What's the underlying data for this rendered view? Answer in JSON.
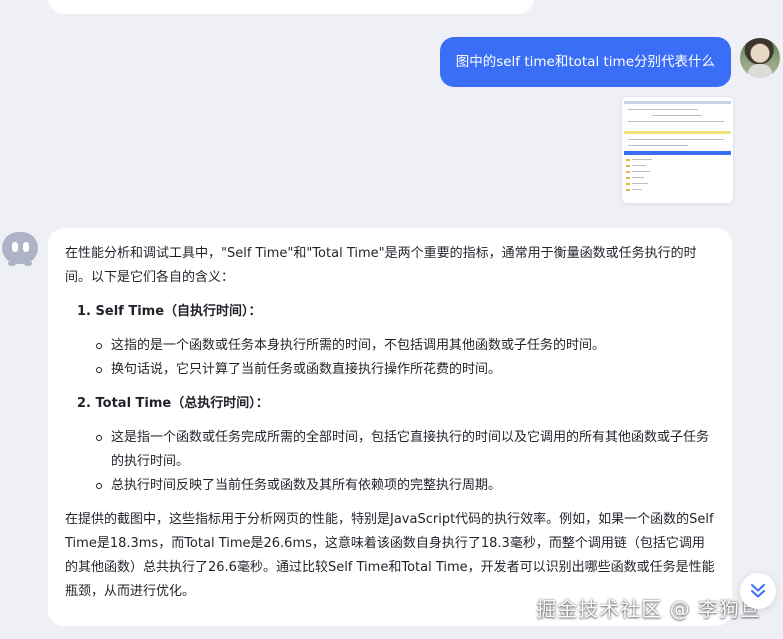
{
  "conversation": {
    "user_message": "图中的self time和total time分别代表什么",
    "answer": {
      "intro": "在性能分析和调试工具中，\"Self Time\"和\"Total Time\"是两个重要的指标，通常用于衡量函数或任务执行的时间。以下是它们各自的含义：",
      "sections": [
        {
          "heading": "1. Self Time（自执行时间）：",
          "bullets": [
            "这指的是一个函数或任务本身执行所需的时间，不包括调用其他函数或子任务的时间。",
            "换句话说，它只计算了当前任务或函数直接执行操作所花费的时间。"
          ]
        },
        {
          "heading": "2. Total Time（总执行时间）：",
          "bullets": [
            "这是指一个函数或任务完成所需的全部时间，包括它直接执行的时间以及它调用的所有其他函数或子任务的执行时间。",
            "总执行时间反映了当前任务或函数及其所有依赖项的完整执行周期。"
          ]
        }
      ],
      "closing": "在提供的截图中，这些指标用于分析网页的性能，特别是JavaScript代码的执行效率。例如，如果一个函数的Self Time是18.3ms，而Total Time是26.6ms，这意味着该函数自身执行了18.3毫秒，而整个调用链（包括它调用的其他函数）总共执行了26.6毫秒。通过比较Self Time和Total Time，开发者可以识别出哪些函数或任务是性能瓶颈，从而进行优化。"
    }
  },
  "watermark": "掘金技术社区 @ 李狗旦",
  "icons": {
    "user_avatar": "user-avatar-photo",
    "bot_avatar": "bot-avatar-icon",
    "scroll_down": "double-chevron-down-icon"
  },
  "colors": {
    "background": "#eef0f6",
    "user_bubble": "#3b6ef6",
    "answer_bubble": "#ffffff",
    "scroll_icon": "#3b6ef6"
  }
}
